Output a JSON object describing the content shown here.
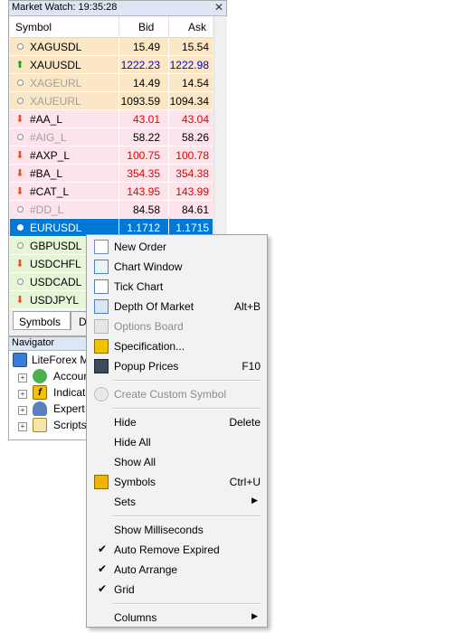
{
  "market_watch": {
    "title": "Market Watch: 19:35:28",
    "columns": {
      "symbol": "Symbol",
      "bid": "Bid",
      "ask": "Ask"
    },
    "rows": [
      {
        "symbol": "XAGUSDL",
        "bid": "15.49",
        "ask": "15.54",
        "state": "neutral",
        "bg": "#fbe7c6",
        "color": "#000000",
        "sym_color": "#000000"
      },
      {
        "symbol": "XAUUSDL",
        "bid": "1222.23",
        "ask": "1222.98",
        "state": "up",
        "bg": "#fbe7c6",
        "color": "#0000c8",
        "sym_color": "#000000"
      },
      {
        "symbol": "XAGEURL",
        "bid": "14.49",
        "ask": "14.54",
        "state": "neutral",
        "bg": "#fbe7c6",
        "color": "#000000",
        "sym_color": "#a0a0a0"
      },
      {
        "symbol": "XAUEURL",
        "bid": "1093.59",
        "ask": "1094.34",
        "state": "neutral",
        "bg": "#fbe7c6",
        "color": "#000000",
        "sym_color": "#a0a0a0"
      },
      {
        "symbol": "#AA_L",
        "bid": "43.01",
        "ask": "43.04",
        "state": "down",
        "bg": "#fde3ea",
        "color": "#e60000",
        "sym_color": "#000000"
      },
      {
        "symbol": "#AIG_L",
        "bid": "58.22",
        "ask": "58.26",
        "state": "neutral",
        "bg": "#fde3ea",
        "color": "#000000",
        "sym_color": "#a0a0a0"
      },
      {
        "symbol": "#AXP_L",
        "bid": "100.75",
        "ask": "100.78",
        "state": "down",
        "bg": "#fde3ea",
        "color": "#e60000",
        "sym_color": "#000000"
      },
      {
        "symbol": "#BA_L",
        "bid": "354.35",
        "ask": "354.38",
        "state": "down",
        "bg": "#fde3ea",
        "color": "#e60000",
        "sym_color": "#000000"
      },
      {
        "symbol": "#CAT_L",
        "bid": "143.95",
        "ask": "143.99",
        "state": "down",
        "bg": "#fde3ea",
        "color": "#e60000",
        "sym_color": "#000000"
      },
      {
        "symbol": "#DD_L",
        "bid": "84.58",
        "ask": "84.61",
        "state": "neutral",
        "bg": "#fde3ea",
        "color": "#000000",
        "sym_color": "#a0a0a0"
      },
      {
        "symbol": "EURUSDL",
        "bid": "1.1712",
        "ask": "1.1715",
        "state": "neutral",
        "bg": "#0078d7",
        "color": "#ffffff",
        "sym_color": "#ffffff",
        "selected": true
      },
      {
        "symbol": "GBPUSDL",
        "bid": "",
        "ask": "",
        "state": "neutral",
        "bg": "#e6f5d8",
        "color": "#000000",
        "sym_color": "#000000"
      },
      {
        "symbol": "USDCHFL",
        "bid": "",
        "ask": "",
        "state": "down",
        "bg": "#e6f5d8",
        "color": "#000000",
        "sym_color": "#000000"
      },
      {
        "symbol": "USDCADL",
        "bid": "",
        "ask": "",
        "state": "neutral",
        "bg": "#e6f5d8",
        "color": "#000000",
        "sym_color": "#000000"
      },
      {
        "symbol": "USDJPYL",
        "bid": "",
        "ask": "",
        "state": "down",
        "bg": "#e6f5d8",
        "color": "#000000",
        "sym_color": "#000000"
      }
    ],
    "tabs": [
      "Symbols",
      "D"
    ]
  },
  "navigator": {
    "title": "Navigator",
    "root": "LiteForex M",
    "items": [
      {
        "label": "Accoun",
        "icon": "accounts-icon"
      },
      {
        "label": "Indicat",
        "icon": "indicators-icon"
      },
      {
        "label": "Expert ",
        "icon": "expert-advisors-icon"
      },
      {
        "label": "Scripts",
        "icon": "scripts-icon"
      }
    ]
  },
  "context_menu": {
    "items": [
      {
        "type": "item",
        "label": "New Order",
        "shortcut": "",
        "icon": "new-order-icon"
      },
      {
        "type": "item",
        "label": "Chart Window",
        "shortcut": "",
        "icon": "chart-window-icon"
      },
      {
        "type": "item",
        "label": "Tick Chart",
        "shortcut": "",
        "icon": "tick-chart-icon"
      },
      {
        "type": "item",
        "label": "Depth Of Market",
        "shortcut": "Alt+B",
        "icon": "depth-of-market-icon"
      },
      {
        "type": "item",
        "label": "Options Board",
        "shortcut": "",
        "icon": "options-board-icon",
        "disabled": true
      },
      {
        "type": "item",
        "label": "Specification...",
        "shortcut": "",
        "icon": "specification-icon"
      },
      {
        "type": "item",
        "label": "Popup Prices",
        "shortcut": "F10",
        "icon": "popup-prices-icon"
      },
      {
        "type": "sep"
      },
      {
        "type": "item",
        "label": "Create Custom Symbol",
        "shortcut": "",
        "icon": "create-custom-symbol-icon",
        "disabled": true
      },
      {
        "type": "sep"
      },
      {
        "type": "item",
        "label": "Hide",
        "shortcut": "Delete"
      },
      {
        "type": "item",
        "label": "Hide All",
        "shortcut": ""
      },
      {
        "type": "item",
        "label": "Show All",
        "shortcut": ""
      },
      {
        "type": "item",
        "label": "Symbols",
        "shortcut": "Ctrl+U",
        "icon": "symbols-icon"
      },
      {
        "type": "item",
        "label": "Sets",
        "shortcut": "",
        "submenu": true
      },
      {
        "type": "sep"
      },
      {
        "type": "item",
        "label": "Show Milliseconds",
        "shortcut": ""
      },
      {
        "type": "item",
        "label": "Auto Remove Expired",
        "shortcut": "",
        "checked": true
      },
      {
        "type": "item",
        "label": "Auto Arrange",
        "shortcut": "",
        "checked": true
      },
      {
        "type": "item",
        "label": "Grid",
        "shortcut": "",
        "checked": true
      },
      {
        "type": "sep"
      },
      {
        "type": "item",
        "label": "Columns",
        "shortcut": "",
        "submenu": true
      }
    ]
  },
  "colors": {
    "up_arrow": "#1aa21a",
    "down_arrow": "#e8501c",
    "accent": "#0078d7"
  }
}
